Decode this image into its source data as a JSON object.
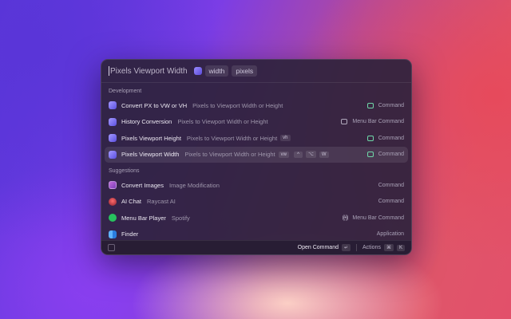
{
  "search": {
    "query": "Pixels Viewport Width",
    "args": [
      "width",
      "pixels"
    ]
  },
  "sections": [
    {
      "title": "Development",
      "items": [
        {
          "title": "Convert PX to VW or VH",
          "subtitle": "Pixels to Viewport Width or Height",
          "type": "Command"
        },
        {
          "title": "History Conversion",
          "subtitle": "Pixels to Viewport Width or Height",
          "type": "Menu Bar Command"
        },
        {
          "title": "Pixels Viewport Height",
          "subtitle": "Pixels to Viewport Width or Height",
          "alias": "vh",
          "type": "Command"
        },
        {
          "title": "Pixels Viewport Width",
          "subtitle": "Pixels to Viewport Width or Height",
          "alias": "vw",
          "hotkeys": [
            "^",
            "⌥",
            "W"
          ],
          "type": "Command"
        }
      ]
    },
    {
      "title": "Suggestions",
      "items": [
        {
          "title": "Convert Images",
          "subtitle": "Image Modification",
          "type": "Command"
        },
        {
          "title": "AI Chat",
          "subtitle": "Raycast AI",
          "type": "Command"
        },
        {
          "title": "Menu Bar Player",
          "subtitle": "Spotify",
          "type": "Menu Bar Command"
        },
        {
          "title": "Finder",
          "subtitle": "",
          "type": "Application"
        }
      ]
    }
  ],
  "footer": {
    "primary_action": "Open Command",
    "primary_key": "↵",
    "actions_label": "Actions",
    "actions_keys": [
      "⌘",
      "K"
    ]
  },
  "icons": {
    "extension": "calculator-extension-icon",
    "image": "image-icon",
    "ai": "raycast-ai-icon",
    "spotify": "spotify-icon",
    "finder": "finder-icon",
    "command_type": "command-icon",
    "menubar_type": "menu-bar-icon",
    "broadcast": "broadcast-icon"
  }
}
